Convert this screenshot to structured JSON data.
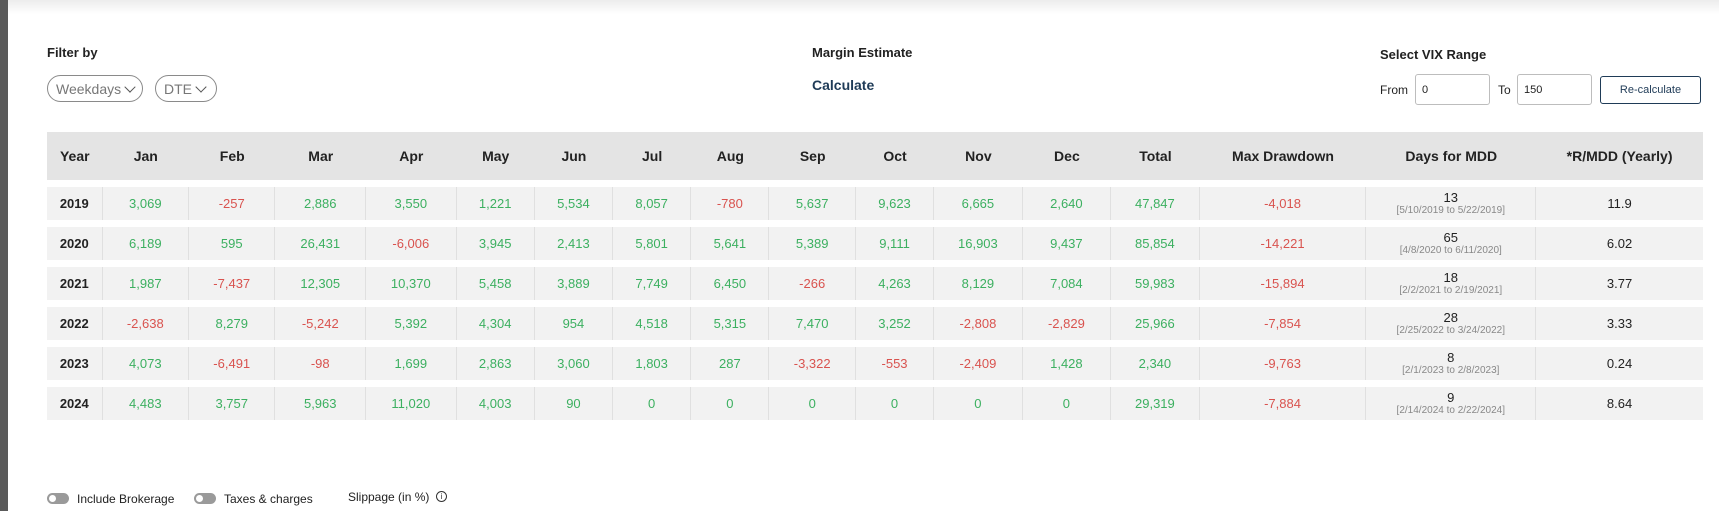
{
  "filter": {
    "title": "Filter by",
    "weekdays_label": "Weekdays",
    "dte_label": "DTE"
  },
  "margin": {
    "title": "Margin Estimate",
    "calculate_label": "Calculate"
  },
  "vix": {
    "title": "Select VIX Range",
    "from_label": "From",
    "from_value": "0",
    "to_label": "To",
    "to_value": "150",
    "recalculate_label": "Re-calculate"
  },
  "table": {
    "headers": [
      "Year",
      "Jan",
      "Feb",
      "Mar",
      "Apr",
      "May",
      "Jun",
      "Jul",
      "Aug",
      "Sep",
      "Oct",
      "Nov",
      "Dec",
      "Total",
      "Max Drawdown",
      "Days for MDD",
      "*R/MDD (Yearly)"
    ],
    "rows": [
      {
        "year": "2019",
        "months": [
          "3,069",
          "-257",
          "2,886",
          "3,550",
          "1,221",
          "5,534",
          "8,057",
          "-780",
          "5,637",
          "9,623",
          "6,665",
          "2,640"
        ],
        "total": "47,847",
        "max_drawdown": "-4,018",
        "mdd_days": "13",
        "mdd_range": "[5/10/2019 to 5/22/2019]",
        "r_mdd": "11.9"
      },
      {
        "year": "2020",
        "months": [
          "6,189",
          "595",
          "26,431",
          "-6,006",
          "3,945",
          "2,413",
          "5,801",
          "5,641",
          "5,389",
          "9,111",
          "16,903",
          "9,437"
        ],
        "total": "85,854",
        "max_drawdown": "-14,221",
        "mdd_days": "65",
        "mdd_range": "[4/8/2020 to 6/11/2020]",
        "r_mdd": "6.02"
      },
      {
        "year": "2021",
        "months": [
          "1,987",
          "-7,437",
          "12,305",
          "10,370",
          "5,458",
          "3,889",
          "7,749",
          "6,450",
          "-266",
          "4,263",
          "8,129",
          "7,084"
        ],
        "total": "59,983",
        "max_drawdown": "-15,894",
        "mdd_days": "18",
        "mdd_range": "[2/2/2021 to 2/19/2021]",
        "r_mdd": "3.77"
      },
      {
        "year": "2022",
        "months": [
          "-2,638",
          "8,279",
          "-5,242",
          "5,392",
          "4,304",
          "954",
          "4,518",
          "5,315",
          "7,470",
          "3,252",
          "-2,808",
          "-2,829"
        ],
        "total": "25,966",
        "max_drawdown": "-7,854",
        "mdd_days": "28",
        "mdd_range": "[2/25/2022 to 3/24/2022]",
        "r_mdd": "3.33"
      },
      {
        "year": "2023",
        "months": [
          "4,073",
          "-6,491",
          "-98",
          "1,699",
          "2,863",
          "3,060",
          "1,803",
          "287",
          "-3,322",
          "-553",
          "-2,409",
          "1,428"
        ],
        "total": "2,340",
        "max_drawdown": "-9,763",
        "mdd_days": "8",
        "mdd_range": "[2/1/2023 to 2/8/2023]",
        "r_mdd": "0.24"
      },
      {
        "year": "2024",
        "months": [
          "4,483",
          "3,757",
          "5,963",
          "11,020",
          "4,003",
          "90",
          "0",
          "0",
          "0",
          "0",
          "0",
          "0"
        ],
        "total": "29,319",
        "max_drawdown": "-7,884",
        "mdd_days": "9",
        "mdd_range": "[2/14/2024 to 2/22/2024]",
        "r_mdd": "8.64"
      }
    ]
  },
  "bottom": {
    "brokerage_label": "Include Brokerage",
    "taxes_label": "Taxes & charges",
    "slippage_label": "Slippage (in %)",
    "info_glyph": "i"
  },
  "colors": {
    "positive": "#3cb060",
    "negative": "#d9534f",
    "accent": "#1f3b57"
  }
}
